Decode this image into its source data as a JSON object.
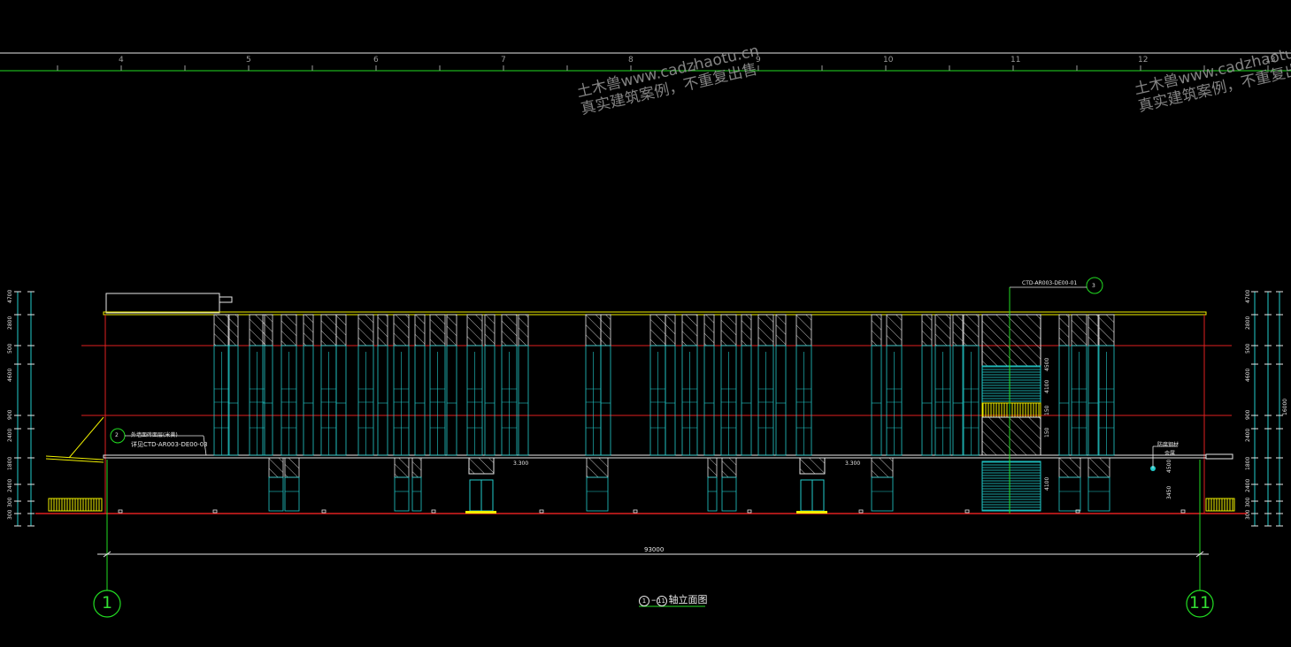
{
  "watermark": {
    "line1": "土木兽www.cadzhaotu.cn",
    "line2": "真实建筑案例，不重复出售"
  },
  "ruler": {
    "numbers": [
      "4",
      "5",
      "6",
      "7",
      "8",
      "9",
      "10",
      "11",
      "12",
      "13"
    ]
  },
  "drawing": {
    "title_axis_left": "1",
    "title_axis_right": "11",
    "title_text": "轴立面图",
    "overall_dimension": "93000",
    "axis_left": "1",
    "axis_right": "11",
    "note_roof_ref": "CTD-AR003-DE00-01",
    "note_ref_num": "3",
    "note_left_line1": "外墙面砖面层(米黄)",
    "note_left_line2": "详见CTD-AR003-DE00-03",
    "note_left_num": "2",
    "note_right_line1": "防腐钢材",
    "note_right_line2": "金属",
    "level_1": "3.300",
    "level_2": "3.300",
    "left_dims": [
      "4700",
      "2800",
      "500",
      "4600",
      "900",
      "2400",
      "1800",
      "2400",
      "300",
      "300"
    ],
    "right_dims": [
      "4700",
      "2800",
      "500",
      "4600",
      "900",
      "2400",
      "1800",
      "2400",
      "300",
      "300"
    ],
    "right_total": "16000",
    "stair_dims": [
      "4500",
      "4100",
      "150",
      "150",
      "4100"
    ],
    "right_small_dims": [
      "4500",
      "3450"
    ]
  },
  "colors": {
    "grid_green": "#22dd22",
    "red": "#e02020",
    "cyan": "#22cccc",
    "yellow": "#f0f000",
    "white": "#e8e8e8"
  }
}
